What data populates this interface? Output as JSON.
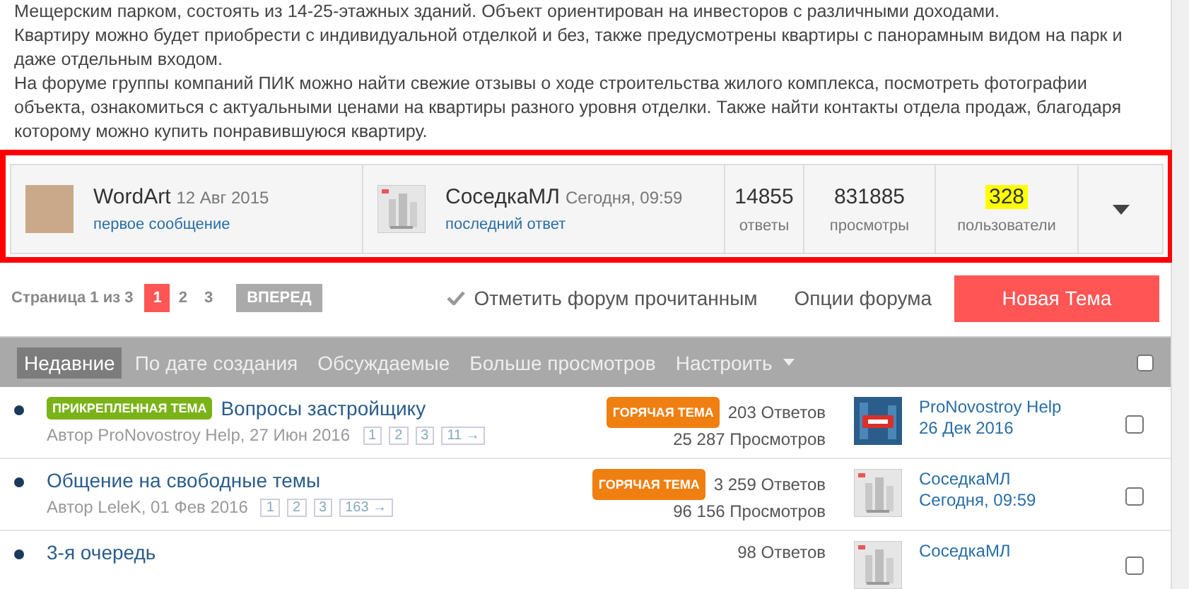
{
  "description": [
    "Мещерским парком, состоять из 14-25-этажных зданий. Объект ориентирован на инвесторов с различными доходами.",
    "Квартиру можно будет приобрести с индивидуальной отделкой и без, также предусмотрены квартиры с панорамным видом на парк и даже отдельным входом.",
    "На форуме группы компаний ПИК можно найти свежие отзывы о ходе строительства жилого комплекса, посмотреть фотографии объекта, ознакомиться с актуальными ценами на квартиры разного уровня отделки. Также найти контакты отдела продаж, благодаря которому можно купить понравившуюся квартиру."
  ],
  "summary": {
    "first": {
      "user": "WordArt",
      "date": "12 Авг 2015",
      "link": "первое сообщение"
    },
    "last": {
      "user": "СоседкаМЛ",
      "date": "Сегодня, 09:59",
      "link": "последний ответ"
    },
    "stats": [
      {
        "value": "14855",
        "label": "ответы",
        "highlighted": false
      },
      {
        "value": "831885",
        "label": "просмотры",
        "highlighted": false
      },
      {
        "value": "328",
        "label": "пользователи",
        "highlighted": true
      }
    ]
  },
  "pager": {
    "label": "Страница 1 из 3",
    "pages": [
      {
        "label": "1",
        "selected": true
      },
      {
        "label": "2",
        "selected": false
      },
      {
        "label": "3",
        "selected": false
      }
    ],
    "next": "ВПЕРЕД"
  },
  "actions": {
    "mark_read": "Отметить форум прочитанным",
    "options": "Опции форума",
    "new_topic": "Новая Тема"
  },
  "tabs": [
    {
      "label": "Недавние",
      "selected": true
    },
    {
      "label": "По дате создания",
      "selected": false
    },
    {
      "label": "Обсуждаемые",
      "selected": false
    },
    {
      "label": "Больше просмотров",
      "selected": false
    }
  ],
  "customize": "Настроить",
  "select_all_checked": false,
  "topics": [
    {
      "badge": "ПРИКРЕПЛЕННАЯ ТЕМА",
      "title": "Вопросы застройщику",
      "author": "Автор ProNovostroy Help, 27 Июн 2016",
      "pages": [
        "1",
        "2",
        "3",
        "11 →"
      ],
      "hot": "ГОРЯЧАЯ ТЕМА",
      "replies": "203 Ответов",
      "views": "25 287 Просмотров",
      "kind": "pro",
      "last_user": "ProNovostroy Help",
      "last_date": "26 Дек 2016",
      "checked": false
    },
    {
      "title": "Общение на свободные темы",
      "author": "Автор LeleK, 01 Фев 2016",
      "pages": [
        "1",
        "2",
        "3",
        "163 →"
      ],
      "hot": "ГОРЯЧАЯ ТЕМА",
      "replies": "3 259 Ответов",
      "views": "96 156 Просмотров",
      "kind": "building",
      "last_user": "СоседкаМЛ",
      "last_date": "Сегодня, 09:59",
      "checked": false
    },
    {
      "title": "3-я очередь",
      "replies": "98 Ответов",
      "kind": "building",
      "last_user": "СоседкаМЛ",
      "checked": false
    }
  ]
}
